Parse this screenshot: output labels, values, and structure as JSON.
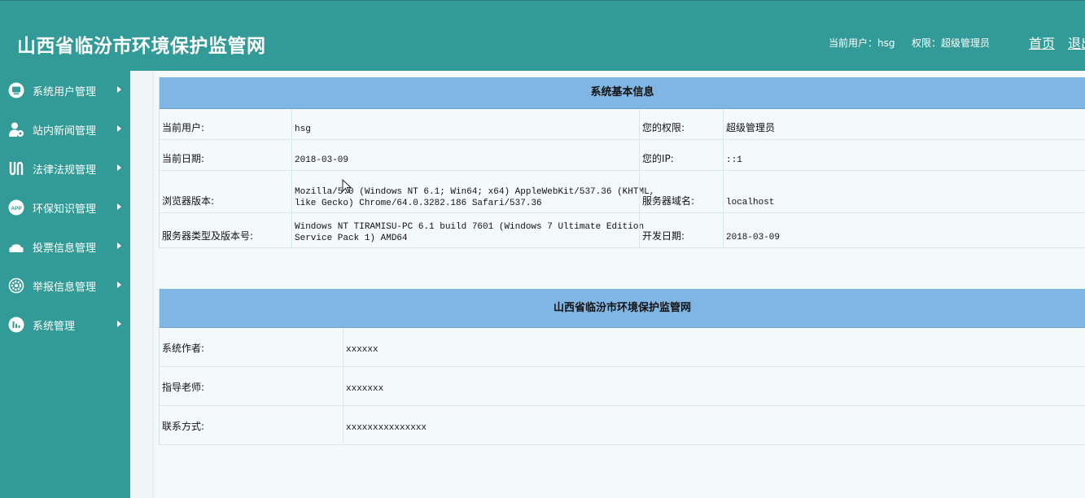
{
  "header": {
    "title": "山西省临汾市环境保护监管网",
    "current_user": "当前用户：hsg",
    "permission": "权限：超级管理员",
    "home_label": "首页",
    "logout_label": "退出"
  },
  "sidebar": {
    "items": [
      {
        "label": "系统用户管理",
        "icon": "monitor-icon"
      },
      {
        "label": "站内新闻管理",
        "icon": "user-gear-icon"
      },
      {
        "label": "法律法规管理",
        "icon": "scale-icon"
      },
      {
        "label": "环保知识管理",
        "icon": "app-icon"
      },
      {
        "label": "投票信息管理",
        "icon": "vote-icon"
      },
      {
        "label": "举报信息管理",
        "icon": "gear-icon"
      },
      {
        "label": "系统管理",
        "icon": "bar-chart-icon"
      }
    ]
  },
  "system_info": {
    "title": "系统基本信息",
    "rows": [
      {
        "label1": "当前用户:",
        "value1": "hsg",
        "label2": "您的权限:",
        "value2": "超级管理员"
      },
      {
        "label1": "当前日期:",
        "value1": "2018-03-09",
        "label2": "您的IP:",
        "value2": "::1"
      },
      {
        "label1": "浏览器版本:",
        "value1": "Mozilla/5.0 (Windows NT 6.1; Win64; x64) AppleWebKit/537.36 (KHTML,\nlike Gecko) Chrome/64.0.3282.186 Safari/537.36",
        "label2": "服务器域名:",
        "value2": "localhost"
      },
      {
        "label1": "服务器类型及版本号:",
        "value1": "Windows NT TIRAMISU-PC 6.1 build 7601 (Windows 7 Ultimate Edition\nService Pack 1) AMD64",
        "label2": "开发日期:",
        "value2": "2018-03-09"
      }
    ]
  },
  "about": {
    "title": "山西省临汾市环境保护监管网",
    "rows": [
      {
        "label": "系统作者:",
        "value": "xxxxxx"
      },
      {
        "label": "指导老师:",
        "value": "xxxxxxx"
      },
      {
        "label": "联系方式:",
        "value": "xxxxxxxxxxxxxxx"
      }
    ]
  },
  "colors": {
    "header_bg": "#329a97",
    "table_head_bg": "#80b6e3",
    "page_bg": "#f4faf9"
  }
}
